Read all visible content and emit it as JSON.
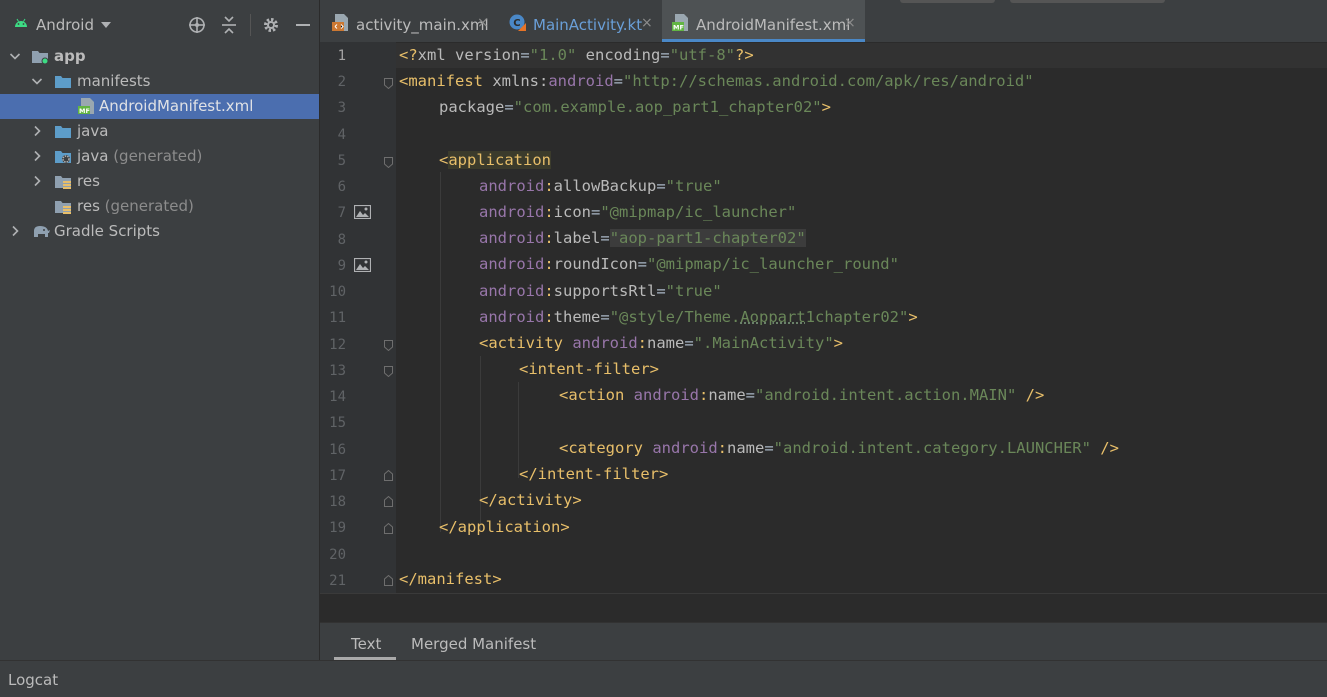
{
  "project_pane": {
    "view_name": "Android",
    "tree": [
      {
        "label": "app",
        "suffix": "",
        "bold": true
      },
      {
        "label": "manifests",
        "suffix": ""
      },
      {
        "label": "AndroidManifest.xml",
        "suffix": "",
        "selected": true
      },
      {
        "label": "java",
        "suffix": ""
      },
      {
        "label": "java",
        "suffix": " (generated)"
      },
      {
        "label": "res",
        "suffix": ""
      },
      {
        "label": "res",
        "suffix": " (generated)"
      },
      {
        "label": "Gradle Scripts",
        "suffix": ""
      }
    ]
  },
  "editor_tabs": [
    {
      "label": "activity_main.xml",
      "close": "×"
    },
    {
      "label": "MainActivity.kt",
      "close": "×"
    },
    {
      "label": "AndroidManifest.xml",
      "close": "×",
      "active": true
    }
  ],
  "line_numbers": [
    "1",
    "2",
    "3",
    "4",
    "5",
    "6",
    "7",
    "8",
    "9",
    "10",
    "11",
    "12",
    "13",
    "14",
    "15",
    "16",
    "17",
    "18",
    "19",
    "20",
    "21"
  ],
  "code": {
    "l1": {
      "a": "<?",
      "b": "xml version",
      "c": "=",
      "d": "\"1.0\"",
      "e": " encoding",
      "f": "=",
      "g": "\"utf-8\"",
      "h": "?>"
    },
    "l2": {
      "tag": "<manifest",
      "attr": " xmlns:",
      "ns": "android",
      "eq": "=",
      "val": "\"http://schemas.android.com/apk/res/android\""
    },
    "l3": {
      "attr": "package",
      "eq": "=",
      "val": "\"com.example.aop_part1_chapter02\"",
      "end": ">"
    },
    "l5": {
      "lt": "<",
      "tag": "application"
    },
    "l6": {
      "ns": "android",
      "colon": ":",
      "attr": "allowBackup",
      "eq": "=",
      "val": "\"true\""
    },
    "l7": {
      "ns": "android",
      "colon": ":",
      "attr": "icon",
      "eq": "=",
      "val": "\"@mipmap/ic_launcher\""
    },
    "l8": {
      "ns": "android",
      "colon": ":",
      "attr": "label",
      "eq": "=",
      "val": "\"aop-part1-chapter02\""
    },
    "l9": {
      "ns": "android",
      "colon": ":",
      "attr": "roundIcon",
      "eq": "=",
      "val": "\"@mipmap/ic_launcher_round\""
    },
    "l10": {
      "ns": "android",
      "colon": ":",
      "attr": "supportsRtl",
      "eq": "=",
      "val": "\"true\""
    },
    "l11": {
      "ns": "android",
      "colon": ":",
      "attr": "theme",
      "eq": "=",
      "val_a": "\"@style/Theme.",
      "val_b": "Aoppart",
      "val_c": "1chapter02\"",
      "end": ">"
    },
    "l12": {
      "tag": "<activity",
      "ns": " android",
      "colon": ":",
      "attr": "name",
      "eq": "=",
      "val": "\".MainActivity\"",
      "end": ">"
    },
    "l13": {
      "tag": "<intent-filter>"
    },
    "l14": {
      "tag": "<action",
      "ns": " android",
      "colon": ":",
      "attr": "name",
      "eq": "=",
      "val": "\"android.intent.action.MAIN\"",
      "end": " />"
    },
    "l16": {
      "tag": "<category",
      "ns": " android",
      "colon": ":",
      "attr": "name",
      "eq": "=",
      "val": "\"android.intent.category.LAUNCHER\"",
      "end": " />"
    },
    "l17": {
      "tag": "</intent-filter>"
    },
    "l18": {
      "tag": "</activity>"
    },
    "l19": {
      "tag": "</application>"
    },
    "l21": {
      "tag": "</manifest>"
    }
  },
  "bottom_tabs": {
    "text": "Text",
    "merged": "Merged Manifest"
  },
  "status_bar": {
    "logcat": "Logcat"
  },
  "colors": {
    "accent": "#4a88c7",
    "selection": "#4b6eaf",
    "tag": "#e8bf6a",
    "namespace": "#9876aa",
    "string": "#6a8759"
  },
  "icons": {
    "pane": "android-icon",
    "locate": "crosshair-icon",
    "collapse": "collapse-all-icon",
    "settings": "gear-icon",
    "hide": "minimize-icon"
  }
}
